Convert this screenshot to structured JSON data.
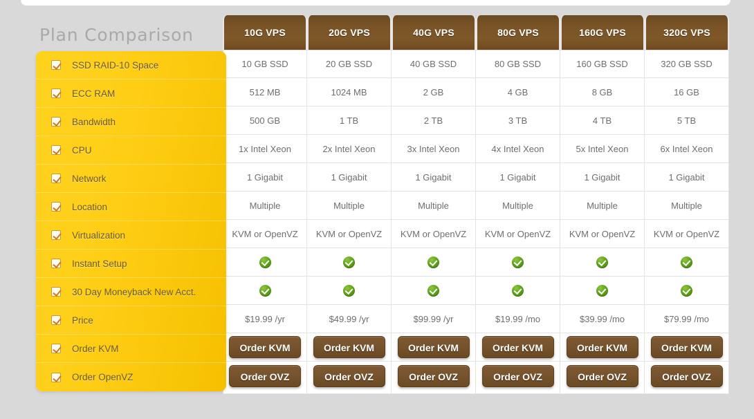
{
  "page": {
    "title": "Plan Comparison"
  },
  "sidebar": {
    "features": [
      {
        "label": "SSD RAID-10 Space",
        "icon": "checkbox-checked-icon"
      },
      {
        "label": "ECC RAM",
        "icon": "checkbox-checked-icon"
      },
      {
        "label": "Bandwidth",
        "icon": "checkbox-checked-icon"
      },
      {
        "label": "CPU",
        "icon": "checkbox-checked-icon"
      },
      {
        "label": "Network",
        "icon": "checkbox-checked-icon"
      },
      {
        "label": "Location",
        "icon": "checkbox-checked-icon"
      },
      {
        "label": "Virtualization",
        "icon": "checkbox-checked-icon"
      },
      {
        "label": "Instant Setup",
        "icon": "checkbox-checked-icon"
      },
      {
        "label": "30 Day Moneyback New Acct.",
        "icon": "checkbox-checked-icon"
      },
      {
        "label": "Price",
        "icon": "checkbox-checked-icon"
      },
      {
        "label": "Order KVM",
        "icon": "checkbox-checked-icon"
      },
      {
        "label": "Order OpenVZ",
        "icon": "checkbox-checked-icon"
      }
    ]
  },
  "table": {
    "columns": [
      "10G VPS",
      "20G VPS",
      "40G VPS",
      "80G VPS",
      "160G VPS",
      "320G VPS"
    ],
    "rows": {
      "ssd": [
        "10 GB SSD",
        "20 GB SSD",
        "40 GB SSD",
        "80 GB SSD",
        "160 GB SSD",
        "320 GB SSD"
      ],
      "ram": [
        "512 MB",
        "1024 MB",
        "2 GB",
        "4 GB",
        "8 GB",
        "16 GB"
      ],
      "bandwidth": [
        "500 GB",
        "1 TB",
        "2 TB",
        "3 TB",
        "4 TB",
        "5 TB"
      ],
      "cpu": [
        "1x Intel Xeon",
        "2x Intel Xeon",
        "3x Intel Xeon",
        "4x Intel Xeon",
        "5x Intel Xeon",
        "6x Intel Xeon"
      ],
      "network": [
        "1 Gigabit",
        "1 Gigabit",
        "1 Gigabit",
        "1 Gigabit",
        "1 Gigabit",
        "1 Gigabit"
      ],
      "location": [
        "Multiple",
        "Multiple",
        "Multiple",
        "Multiple",
        "Multiple",
        "Multiple"
      ],
      "virtualization": [
        "KVM or OpenVZ",
        "KVM or OpenVZ",
        "KVM or OpenVZ",
        "KVM or OpenVZ",
        "KVM or OpenVZ",
        "KVM or OpenVZ"
      ],
      "instant_setup": [
        "yes",
        "yes",
        "yes",
        "yes",
        "yes",
        "yes"
      ],
      "moneyback": [
        "yes",
        "yes",
        "yes",
        "yes",
        "yes",
        "yes"
      ],
      "price": [
        "$19.99 /yr",
        "$49.99 /yr",
        "$99.99 /yr",
        "$19.99 /mo",
        "$39.99 /mo",
        "$79.99 /mo"
      ],
      "order_kvm": [
        "Order KVM",
        "Order KVM",
        "Order KVM",
        "Order KVM",
        "Order KVM",
        "Order KVM"
      ],
      "order_ovz": [
        "Order OVZ",
        "Order OVZ",
        "Order OVZ",
        "Order OVZ",
        "Order OVZ",
        "Order OVZ"
      ]
    },
    "check_icon": "green-check-circle-icon"
  },
  "colors": {
    "header_brown": "#7a5426",
    "button_brown": "#76532c",
    "sidebar_yellow": "#fcc90e",
    "page_background": "#d9d9d9",
    "check_green": "#63a51c",
    "cell_text": "#6e6e6e"
  }
}
